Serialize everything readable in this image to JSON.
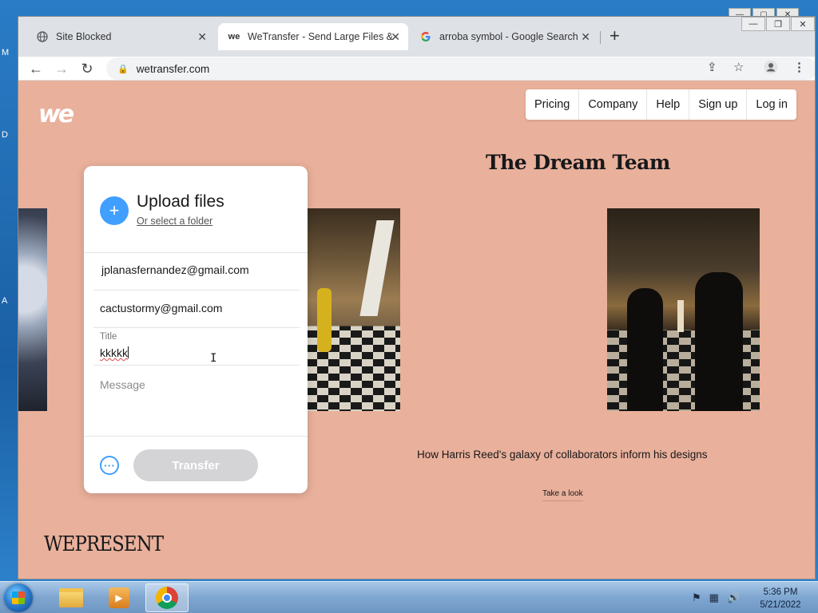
{
  "tabs": [
    {
      "label": "Site Blocked",
      "icon": "globe-icon"
    },
    {
      "label": "WeTransfer - Send Large Files &",
      "icon": "wetransfer-icon"
    },
    {
      "label": "arroba symbol - Google Search",
      "icon": "google-icon"
    }
  ],
  "address": {
    "url": "wetransfer.com"
  },
  "site": {
    "logo": "we",
    "nav": [
      "Pricing",
      "Company",
      "Help",
      "Sign up",
      "Log in"
    ],
    "hero_title": "The Dream Team",
    "caption": "How Harris Reed's galaxy of collaborators inform his designs",
    "cta": "Take a look",
    "brand": "WEPRESENT"
  },
  "upload": {
    "title": "Upload files",
    "folder_link": "Or select a folder",
    "email_to": "jplanasfernandez@gmail.com",
    "email_from": "cactustormy@gmail.com",
    "title_label": "Title",
    "title_value": "kkkkk",
    "message_placeholder": "Message",
    "transfer_label": "Transfer"
  },
  "taskbar": {
    "time": "5:36 PM",
    "date": "5/21/2022"
  },
  "colors": {
    "page_bg": "#e9b09b",
    "accent": "#409fff"
  }
}
